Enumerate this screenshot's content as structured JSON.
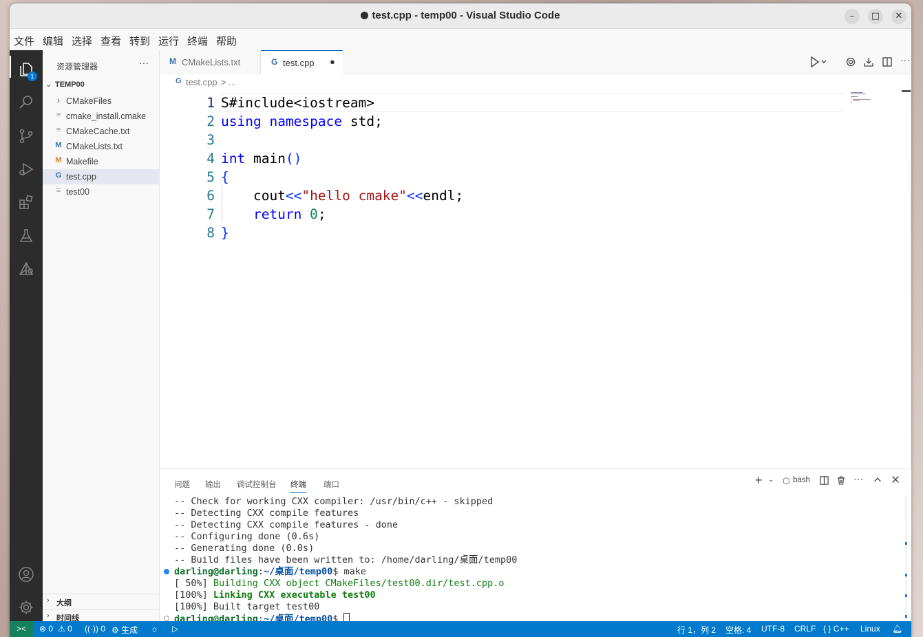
{
  "window": {
    "title": "test.cpp - temp00 - Visual Studio Code",
    "controls": {
      "minimize": "–",
      "maximize": "□",
      "close": "✕"
    }
  },
  "menu": [
    "文件",
    "编辑",
    "选择",
    "查看",
    "转到",
    "运行",
    "终端",
    "帮助"
  ],
  "activity": {
    "explorer_badge": "1"
  },
  "sidebar": {
    "title": "资源管理器",
    "more": "···",
    "root": "TEMP00",
    "files": [
      {
        "name": "CMakeFiles",
        "icon": "chevron-right-icon",
        "glyph": "›"
      },
      {
        "name": "cmake_install.cmake",
        "icon": "lines-icon",
        "glyph": "≡"
      },
      {
        "name": "CMakeCache.txt",
        "icon": "lines-icon",
        "glyph": "≡"
      },
      {
        "name": "CMakeLists.txt",
        "icon": "m-icon",
        "glyph": "M"
      },
      {
        "name": "Makefile",
        "icon": "m-icon",
        "glyph": "M"
      },
      {
        "name": "test.cpp",
        "icon": "cpp-icon",
        "glyph": "G"
      },
      {
        "name": "test00",
        "icon": "lines-icon",
        "glyph": "≡"
      }
    ],
    "sections": [
      "大纲",
      "时间线"
    ]
  },
  "tabs": [
    {
      "label": "CMakeLists.txt",
      "glyph": "M"
    },
    {
      "label": "test.cpp",
      "glyph": "G",
      "dirty": "●"
    }
  ],
  "breadcrumb": {
    "file": "test.cpp",
    "rest": "> ..."
  },
  "editor": {
    "line_numbers": [
      "1",
      "2",
      "3",
      "4",
      "5",
      "6",
      "7",
      "8"
    ],
    "lines": [
      [
        {
          "t": "S#include<iostream>",
          "c": ""
        }
      ],
      [
        {
          "t": "using",
          "c": "kw"
        },
        {
          "t": " ",
          "c": ""
        },
        {
          "t": "namespace",
          "c": "kw"
        },
        {
          "t": " std;",
          "c": ""
        }
      ],
      [],
      [
        {
          "t": "int",
          "c": "kw"
        },
        {
          "t": " main",
          "c": ""
        },
        {
          "t": "()",
          "c": "br1"
        }
      ],
      [
        {
          "t": "{",
          "c": "br1"
        }
      ],
      [
        {
          "t": "    cout",
          "c": ""
        },
        {
          "t": "<<",
          "c": "br1"
        },
        {
          "t": "\"hello cmake\"",
          "c": "str"
        },
        {
          "t": "<<",
          "c": "br1"
        },
        {
          "t": "endl;",
          "c": ""
        }
      ],
      [
        {
          "t": "    ",
          "c": ""
        },
        {
          "t": "return",
          "c": "kw"
        },
        {
          "t": " ",
          "c": ""
        },
        {
          "t": "0",
          "c": "num"
        },
        {
          "t": ";",
          "c": ""
        }
      ],
      [
        {
          "t": "}",
          "c": "br1"
        }
      ]
    ]
  },
  "panel": {
    "tabs": [
      "问题",
      "输出",
      "调试控制台",
      "终端",
      "端口"
    ],
    "active_tab": "终端",
    "terminal_name": "bash",
    "terminal": [
      [
        {
          "t": "-- Check for working CXX compiler: /usr/bin/c++ - skipped",
          "c": ""
        }
      ],
      [
        {
          "t": "-- Detecting CXX compile features",
          "c": ""
        }
      ],
      [
        {
          "t": "-- Detecting CXX compile features - done",
          "c": ""
        }
      ],
      [
        {
          "t": "-- Configuring done (0.6s)",
          "c": ""
        }
      ],
      [
        {
          "t": "-- Generating done (0.0s)",
          "c": ""
        }
      ],
      [
        {
          "t": "-- Build files have been written to: /home/darling/桌面/temp00",
          "c": ""
        }
      ],
      [
        {
          "t": "darling@darling",
          "c": "prompt"
        },
        {
          "t": ":",
          "c": ""
        },
        {
          "t": "~/桌面/temp00",
          "c": "path"
        },
        {
          "t": "$ make",
          "c": ""
        }
      ],
      [
        {
          "t": "[ 50%] ",
          "c": ""
        },
        {
          "t": "Building CXX object CMakeFiles/test00.dir/test.cpp.o",
          "c": "tgreen"
        }
      ],
      [
        {
          "t": "[100%] ",
          "c": ""
        },
        {
          "t": "Linking CXX executable test00",
          "c": "tgreen tbold"
        }
      ],
      [
        {
          "t": "[100%] Built target test00",
          "c": ""
        }
      ],
      [
        {
          "t": "darling@darling",
          "c": "prompt"
        },
        {
          "t": ":",
          "c": ""
        },
        {
          "t": "~/桌面/temp00",
          "c": "path"
        },
        {
          "t": "$ ",
          "c": ""
        }
      ]
    ]
  },
  "status": {
    "remote": "><",
    "errors": "⊗ 0",
    "warnings": "⚠ 0",
    "ports": "0",
    "build": "生成",
    "position": "行 1，列 2",
    "spaces": "空格: 4",
    "encoding": "UTF-8",
    "eol": "CRLF",
    "language": "{ } C++",
    "platform": "Linux"
  },
  "colors": {
    "accent": "#005fb8",
    "statusbar": "#007acc",
    "remote": "#16825d",
    "activitybar": "#2c2c2c"
  }
}
